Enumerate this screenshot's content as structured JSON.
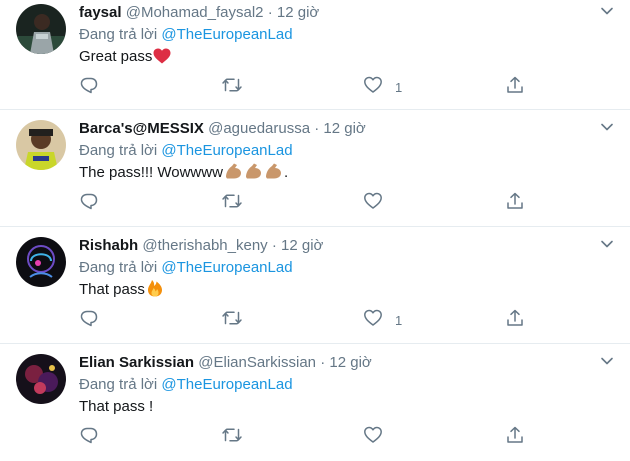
{
  "ui": {
    "reply_prefix": "Đang trả lời",
    "dot": "·"
  },
  "colors": {
    "text": "#14171a",
    "secondary": "#657786",
    "link": "#1b95e0",
    "divider": "#e6ecf0",
    "heart": "#e0245e",
    "fire": "#f4900c"
  },
  "tweets": [
    {
      "name": "faysal",
      "handle": "@Mohamad_faysal2",
      "time": "12 giờ",
      "reply_to": "@TheEuropeanLad",
      "text": "Great pass",
      "emoji": "red-heart",
      "like_count": "1"
    },
    {
      "name": "Barca's@MESSIX",
      "handle": "@aguedarussa",
      "time": "12 giờ",
      "reply_to": "@TheEuropeanLad",
      "text": "The pass!!! Wowwww",
      "emoji": "flexed-biceps-x3",
      "text_after": ".",
      "like_count": ""
    },
    {
      "name": "Rishabh",
      "handle": "@therishabh_keny",
      "time": "12 giờ",
      "reply_to": "@TheEuropeanLad",
      "text": "That pass",
      "emoji": "fire",
      "like_count": "1"
    },
    {
      "name": "Elian Sarkissian",
      "handle": "@ElianSarkissian",
      "time": "12 giờ",
      "reply_to": "@TheEuropeanLad",
      "text": "That pass !",
      "emoji": "",
      "like_count": ""
    }
  ],
  "icons": {
    "reply": "reply-icon",
    "retweet": "retweet-icon",
    "like": "like-icon",
    "share": "share-icon",
    "caret": "chevron-down-icon"
  }
}
